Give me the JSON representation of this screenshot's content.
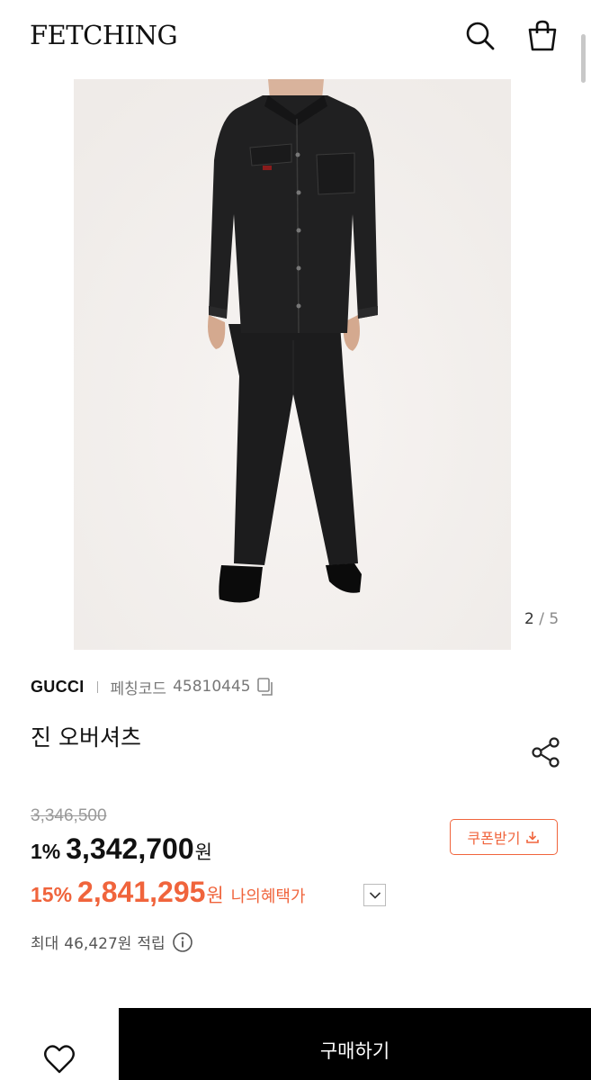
{
  "header": {
    "logo": "FETCHING",
    "search_icon": "search-icon",
    "bag_icon": "shopping-bag-icon"
  },
  "gallery": {
    "current": "2",
    "separator": "/",
    "total": "5"
  },
  "product": {
    "brand": "GUCCI",
    "code_label": "페칭코드",
    "code": "45810445",
    "title": "진 오버셔츠"
  },
  "pricing": {
    "original": "3,346,500",
    "discount1": "1%",
    "price1": "3,342,700",
    "currency": "원",
    "discount2": "15%",
    "price2": "2,841,295",
    "benefit_label": "나의혜택가",
    "coupon_label": "쿠폰받기",
    "points_max": "최대",
    "points_value": "46,427원",
    "points_label": "적립"
  },
  "actions": {
    "buy_label": "구매하기"
  },
  "colors": {
    "accent": "#f0643c",
    "buy_bg": "#000000"
  }
}
